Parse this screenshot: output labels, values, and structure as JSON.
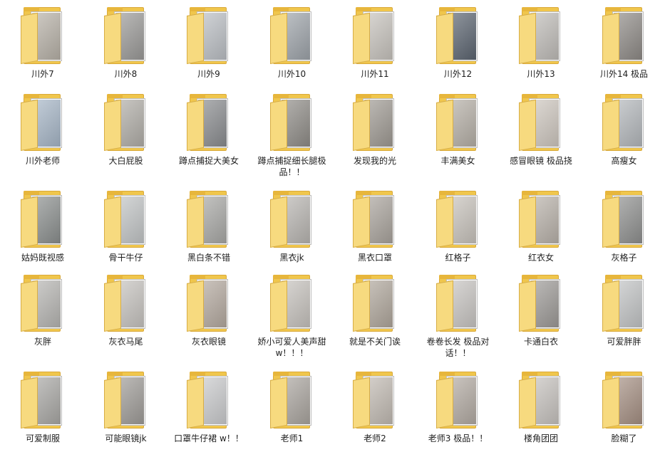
{
  "folders": [
    {
      "name": "川外7",
      "thumb": "#b8b2a8"
    },
    {
      "name": "川外8",
      "thumb": "#9b9a98"
    },
    {
      "name": "川外9",
      "thumb": "#bcc0c5"
    },
    {
      "name": "川外10",
      "thumb": "#9ea4aa"
    },
    {
      "name": "川外11",
      "thumb": "#c8c4be"
    },
    {
      "name": "川外12",
      "thumb": "#5b6470"
    },
    {
      "name": "川外13",
      "thumb": "#c0bdb9"
    },
    {
      "name": "川外14 极品",
      "thumb": "#8e8a86"
    },
    {
      "name": "川外老师",
      "thumb": "#a7b7c8"
    },
    {
      "name": "大白屁股",
      "thumb": "#b1aea8"
    },
    {
      "name": "蹲点捕捉大美女",
      "thumb": "#8a8c8f"
    },
    {
      "name": "蹲点捕捉细长腿极品！！",
      "thumb": "#8f8c87"
    },
    {
      "name": "发现我的光",
      "thumb": "#9f9a93"
    },
    {
      "name": "丰满美女",
      "thumb": "#b6b0a7"
    },
    {
      "name": "感冒眼镜 极品挠",
      "thumb": "#cfc8c0"
    },
    {
      "name": "高瘦女",
      "thumb": "#b4b8bc"
    },
    {
      "name": "姑妈既视感",
      "thumb": "#8b8f8e"
    },
    {
      "name": "骨干牛仔",
      "thumb": "#c3c6c7"
    },
    {
      "name": "黑白条不错",
      "thumb": "#a9a9a6"
    },
    {
      "name": "黑衣jk",
      "thumb": "#b9b6b2"
    },
    {
      "name": "黑衣口罩",
      "thumb": "#aaa49d"
    },
    {
      "name": "红格子",
      "thumb": "#c9c4bd"
    },
    {
      "name": "红衣女",
      "thumb": "#b9b2aa"
    },
    {
      "name": "灰格子",
      "thumb": "#8f908f"
    },
    {
      "name": "灰胖",
      "thumb": "#b7b6b3"
    },
    {
      "name": "灰衣马尾",
      "thumb": "#c7c4c0"
    },
    {
      "name": "灰衣眼镜",
      "thumb": "#b5aaa0"
    },
    {
      "name": "娇小可爱人美声甜 w！！！",
      "thumb": "#c7c3be"
    },
    {
      "name": "就是不关门诶",
      "thumb": "#b0a79c"
    },
    {
      "name": "卷卷长发 极品对话！！",
      "thumb": "#c9c6c3"
    },
    {
      "name": "卡通白衣",
      "thumb": "#9d9a97"
    },
    {
      "name": "可爱胖胖",
      "thumb": "#c3c5c6"
    },
    {
      "name": "可爱制服",
      "thumb": "#a9a8a5"
    },
    {
      "name": "可能眼镜jk",
      "thumb": "#9f9c98"
    },
    {
      "name": "口罩牛仔裙 w！！",
      "thumb": "#cbccce"
    },
    {
      "name": "老师1",
      "thumb": "#aaa59f"
    },
    {
      "name": "老师2",
      "thumb": "#c2bbb3"
    },
    {
      "name": "老师3 极品！！",
      "thumb": "#b3aba3"
    },
    {
      "name": "楼角团团",
      "thumb": "#c7c3bf"
    },
    {
      "name": "脸糊了",
      "thumb": "#a58f82"
    }
  ]
}
